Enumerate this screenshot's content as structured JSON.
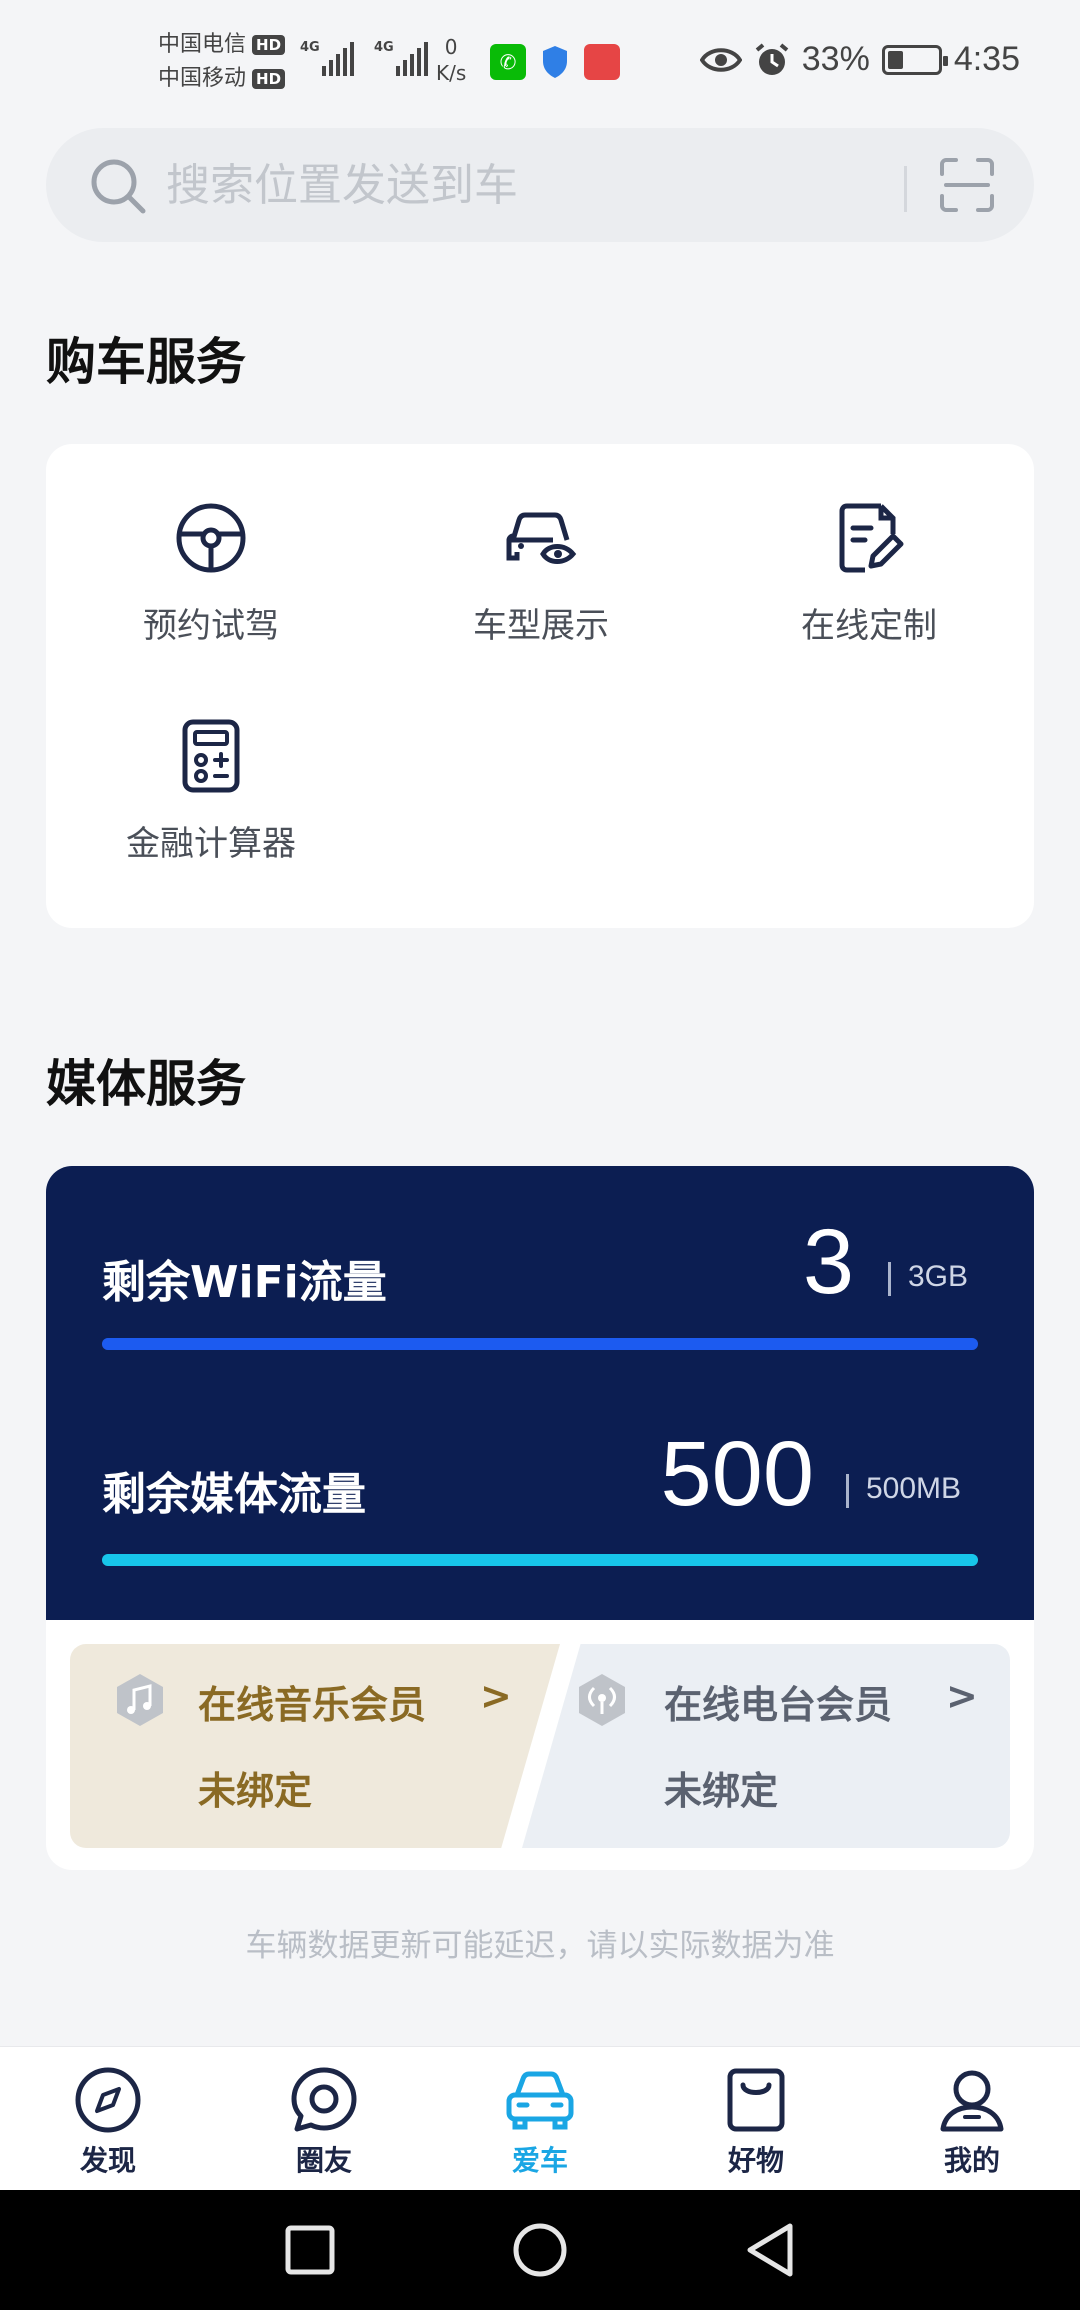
{
  "status_bar": {
    "carrier_1": "中国电信",
    "carrier_2": "中国移动",
    "hd_1": "HD",
    "hd_2": "HD",
    "net_type_1": "4G",
    "net_type_2": "4G",
    "speed_value": "0",
    "speed_unit": "K/s",
    "battery_percent": "33%",
    "battery_level": 0.33,
    "time": "4:35"
  },
  "search": {
    "placeholder": "搜索位置发送到车"
  },
  "purchase_section": {
    "title": "购车服务",
    "items": [
      {
        "label": "预约试驾",
        "icon": "steering-wheel-icon"
      },
      {
        "label": "车型展示",
        "icon": "car-view-icon"
      },
      {
        "label": "在线定制",
        "icon": "customize-doc-icon"
      },
      {
        "label": "金融计算器",
        "icon": "calculator-icon"
      }
    ]
  },
  "media_section": {
    "title": "媒体服务",
    "wifi": {
      "label": "剩余WiFi流量",
      "value": "3",
      "unit": "3GB",
      "fraction": 1.0
    },
    "media": {
      "label": "剩余媒体流量",
      "value": "500",
      "unit": "500MB",
      "fraction": 1.0
    },
    "music_member": {
      "title": "在线音乐会员",
      "arrow": ">",
      "status": "未绑定"
    },
    "radio_member": {
      "title": "在线电台会员",
      "arrow": ">",
      "status": "未绑定"
    }
  },
  "footnote": "车辆数据更新可能延迟，请以实际数据为准",
  "bottom_nav": {
    "items": [
      {
        "label": "发现",
        "icon": "compass-icon"
      },
      {
        "label": "圈友",
        "icon": "chat-bubble-icon"
      },
      {
        "label": "爱车",
        "icon": "car-icon",
        "active": true
      },
      {
        "label": "好物",
        "icon": "shopping-bag-icon"
      },
      {
        "label": "我的",
        "icon": "user-icon"
      }
    ]
  },
  "colors": {
    "accent": "#1aa6e4",
    "media_bg": "#0c1e52",
    "wifi_bar": "#1c5bf0",
    "media_bar": "#17c6ea",
    "music_text": "#8a6a24"
  }
}
